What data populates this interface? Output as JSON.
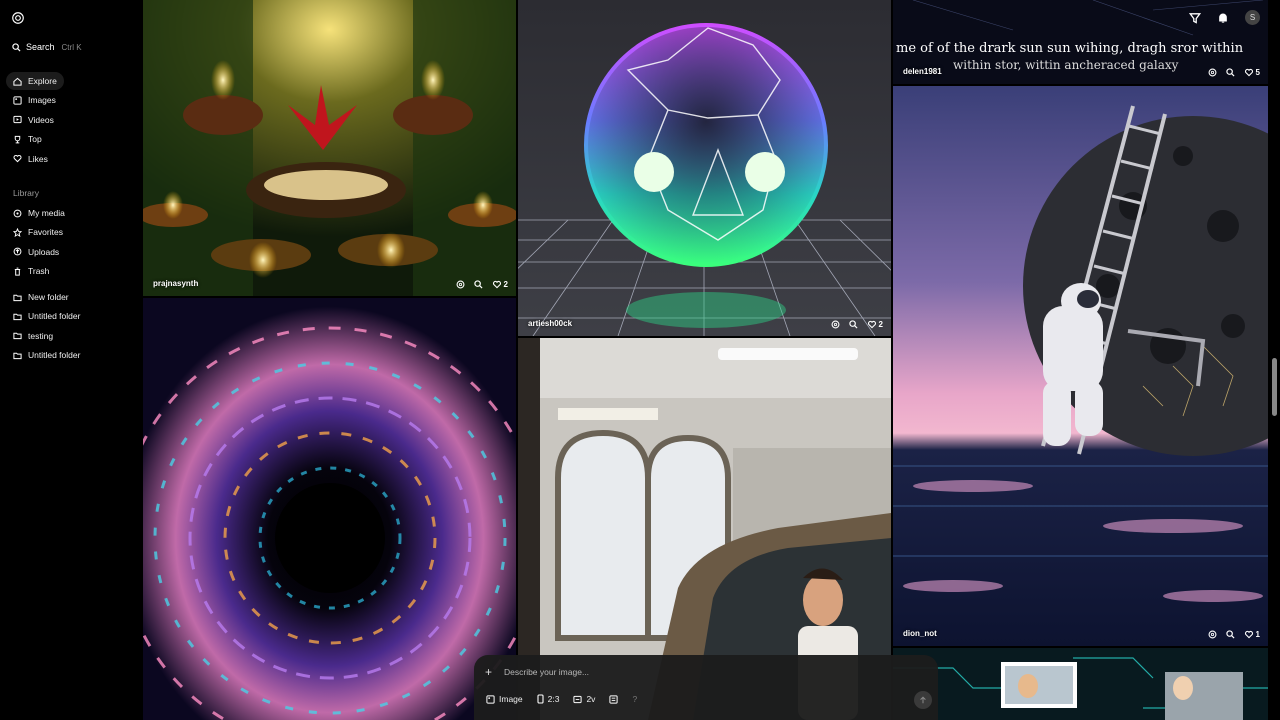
{
  "sidebar": {
    "search_label": "Search",
    "search_shortcut": "Ctrl K",
    "nav": [
      {
        "label": "Explore",
        "icon": "home-icon"
      },
      {
        "label": "Images",
        "icon": "image-icon"
      },
      {
        "label": "Videos",
        "icon": "video-icon"
      },
      {
        "label": "Top",
        "icon": "trophy-icon"
      },
      {
        "label": "Likes",
        "icon": "heart-icon"
      }
    ],
    "library_label": "Library",
    "library": [
      {
        "label": "My media",
        "icon": "media-icon"
      },
      {
        "label": "Favorites",
        "icon": "star-icon"
      },
      {
        "label": "Uploads",
        "icon": "upload-icon"
      },
      {
        "label": "Trash",
        "icon": "trash-icon"
      }
    ],
    "folders": [
      {
        "label": "New folder",
        "icon": "folder-icon"
      },
      {
        "label": "Untitled folder",
        "icon": "folder-icon"
      },
      {
        "label": "testing",
        "icon": "folder-icon"
      },
      {
        "label": "Untitled folder",
        "icon": "folder-icon"
      }
    ]
  },
  "header": {
    "avatar_letter": "S"
  },
  "tiles": {
    "diya": {
      "user": "prajnasynth",
      "likes": "2"
    },
    "orb": {
      "user": "artiesh00ck",
      "likes": "2"
    },
    "galaxy": {
      "user": "delen1981",
      "likes": "5",
      "caption_line1": "me of of the drark sun sun wihing, dragh sror within",
      "caption_line2": "within stor, wittin ancheraced galaxy"
    },
    "astronaut": {
      "user": "dion_not",
      "likes": "1"
    }
  },
  "prompt": {
    "placeholder": "Describe your image...",
    "mode_label": "Image",
    "ratio_label": "2:3",
    "variations_label": "2v",
    "help_label": "?"
  },
  "colors": {
    "background": "#000000",
    "active_nav": "#1c1c1c",
    "prompt_bg": "#1c1c1c"
  }
}
